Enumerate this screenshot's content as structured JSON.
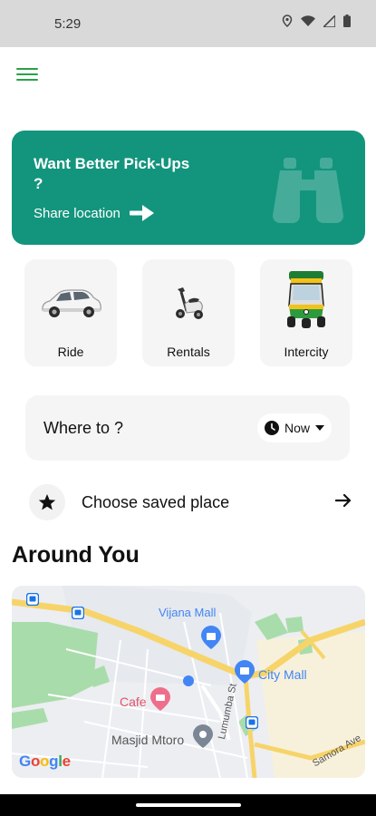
{
  "status_bar": {
    "time": "5:29"
  },
  "banner": {
    "title": "Want Better Pick-Ups ?",
    "link_label": "Share location",
    "color": "#13957d"
  },
  "services": [
    {
      "label": "Ride",
      "icon": "car-icon"
    },
    {
      "label": "Rentals",
      "icon": "scooter-icon"
    },
    {
      "label": "Intercity",
      "icon": "auto-rickshaw-icon"
    }
  ],
  "where_to": {
    "label": "Where to ?",
    "time_option": "Now"
  },
  "saved_place": {
    "label": "Choose saved place"
  },
  "around": {
    "title": "Around You"
  },
  "map": {
    "places": {
      "vijana_mall": "Vijana Mall",
      "city_mall": "City Mall",
      "cafe": "Cafe",
      "masjid": "Masjid Mtoro",
      "lumumba": "Lumumba St",
      "samora": "Samora Ave"
    },
    "attribution": "Google"
  },
  "accent_color": "#2aa04a"
}
